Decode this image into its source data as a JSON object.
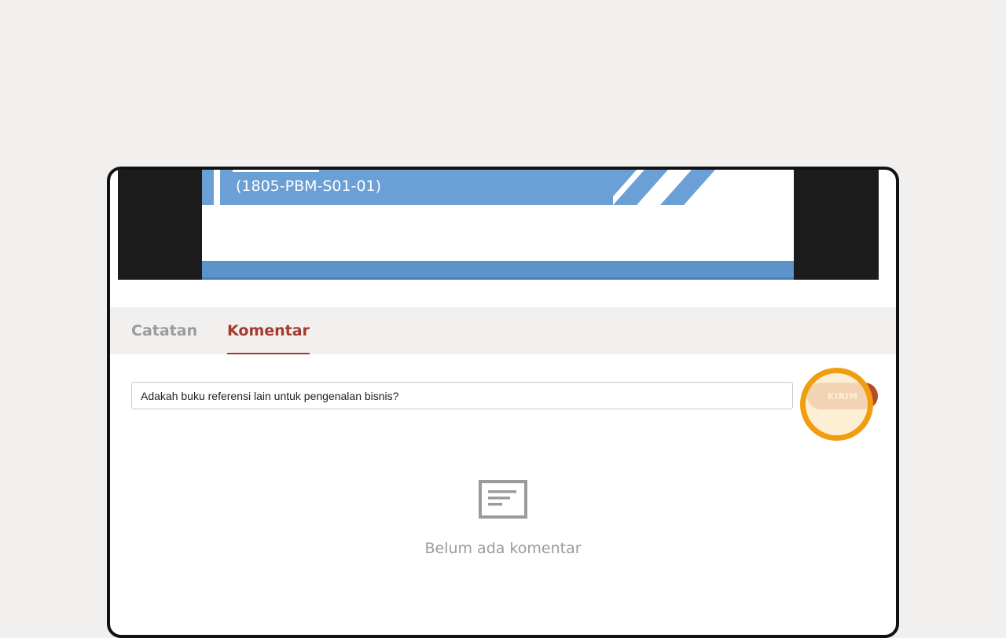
{
  "video": {
    "slide_code": "(1805-PBM-S01-01)"
  },
  "tabs": [
    {
      "label": "Catatan",
      "active": false
    },
    {
      "label": "Komentar",
      "active": true
    }
  ],
  "comment": {
    "value": "Adakah buku referensi lain untuk pengenalan bisnis?",
    "send_label": "KIRIM"
  },
  "empty_state": {
    "icon": "comment-list-icon",
    "message": "Belum ada komentar"
  },
  "colors": {
    "accent": "#a63a2c",
    "send_button": "#b44a2b",
    "highlight": "#f09e0f",
    "slide_blue": "#6aa0d6"
  }
}
